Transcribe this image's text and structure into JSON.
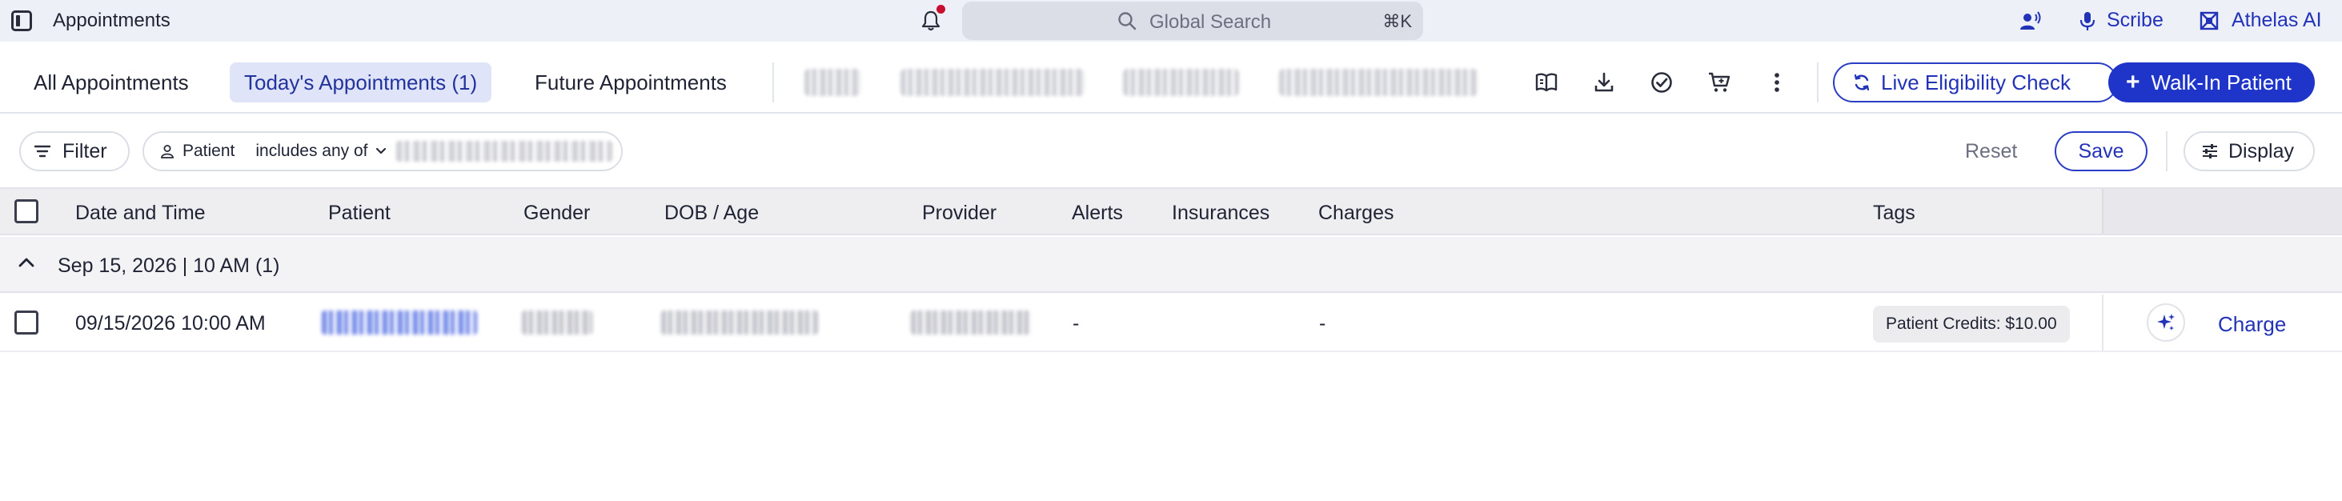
{
  "topbar": {
    "title": "Appointments",
    "search_placeholder": "Global Search",
    "search_shortcut": "⌘K",
    "scribe_label": "Scribe",
    "ai_label": "Athelas AI",
    "icons": [
      "sidebar-toggle-icon",
      "bell-icon",
      "search-icon",
      "voice-user-icon",
      "microphone-icon",
      "athelas-logo-icon"
    ],
    "notification_dot_color": "#c8102e"
  },
  "tabs": [
    {
      "label": "All Appointments",
      "active": false
    },
    {
      "label": "Today's Appointments (1)",
      "active": true
    },
    {
      "label": "Future Appointments",
      "active": false
    }
  ],
  "toolbar": {
    "icons": [
      "book-open-icon",
      "download-icon",
      "check-circle-icon",
      "cart-icon",
      "more-vertical-icon"
    ],
    "live_eligibility_label": "Live Eligibility Check",
    "walk_in_label": "Walk-In Patient",
    "accent_color": "#1f34c9"
  },
  "filterbar": {
    "filter_label": "Filter",
    "chip_field": "Patient",
    "chip_operator": "includes any of",
    "reset_label": "Reset",
    "save_label": "Save",
    "display_label": "Display"
  },
  "table": {
    "columns": [
      "Date and Time",
      "Patient",
      "Gender",
      "DOB / Age",
      "Provider",
      "Alerts",
      "Insurances",
      "Charges",
      "Tags"
    ],
    "groups": [
      {
        "label": "Sep 15, 2026 | 10 AM (1)",
        "expanded": true,
        "rows": [
          {
            "date_time": "09/15/2026 10:00 AM",
            "alerts": "-",
            "charges": "-",
            "tag": "Patient Credits: $10.00",
            "action_label": "Charge"
          }
        ]
      }
    ]
  }
}
